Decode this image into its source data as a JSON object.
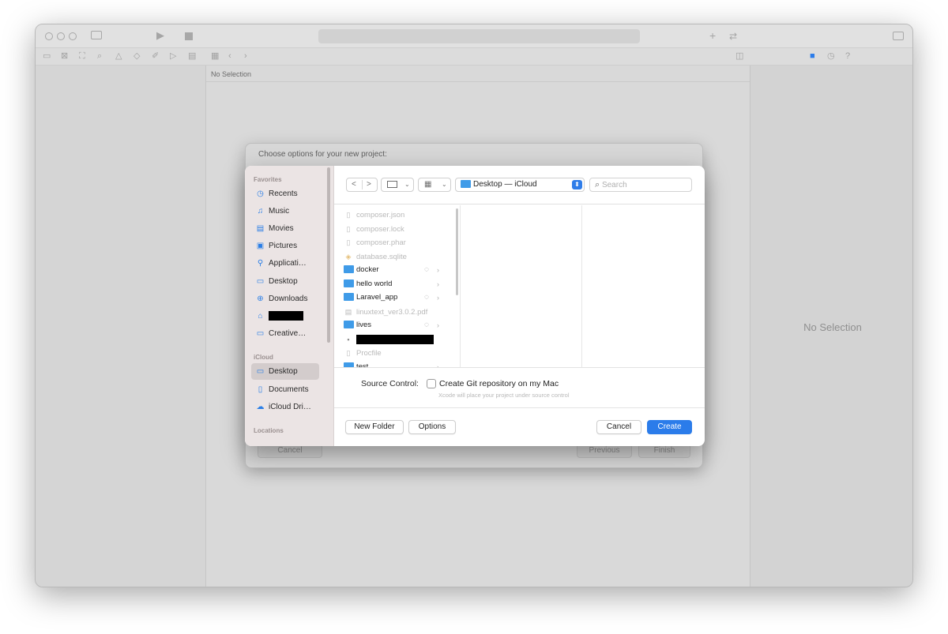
{
  "window": {
    "jump_bar": "No Selection",
    "inspector_empty": "No Selection",
    "toolbar_icons": [
      "sidebar-icon",
      "play-icon",
      "stop-icon",
      "plus-icon",
      "swap-icon",
      "inspector-toggle-icon"
    ],
    "nav_icons": [
      "folder-icon",
      "source-control-icon",
      "hierarchy-icon",
      "search-icon",
      "warning-icon",
      "test-icon",
      "debug-icon",
      "breakpoint-icon",
      "report-icon"
    ],
    "inspector_icons": [
      "file-icon",
      "history-icon",
      "help-icon"
    ]
  },
  "template_sheet": {
    "title": "Choose options for your new project:",
    "cancel": "Cancel",
    "previous": "Previous",
    "finish": "Finish"
  },
  "save_panel": {
    "sidebar": {
      "favorites_header": "Favorites",
      "favorites": [
        {
          "label": "Recents",
          "icon": "clock-icon"
        },
        {
          "label": "Music",
          "icon": "music-icon"
        },
        {
          "label": "Movies",
          "icon": "film-icon"
        },
        {
          "label": "Pictures",
          "icon": "photo-icon"
        },
        {
          "label": "Applicati…",
          "icon": "apps-icon"
        },
        {
          "label": "Desktop",
          "icon": "desktop-icon"
        },
        {
          "label": "Downloads",
          "icon": "download-icon"
        },
        {
          "label": "",
          "icon": "home-icon"
        },
        {
          "label": "Creative…",
          "icon": "folder-icon"
        }
      ],
      "icloud_header": "iCloud",
      "icloud": [
        {
          "label": "Desktop",
          "icon": "desktop-icon"
        },
        {
          "label": "Documents",
          "icon": "document-icon"
        },
        {
          "label": "iCloud Dri…",
          "icon": "cloud-icon"
        }
      ],
      "locations_header": "Locations"
    },
    "toolbar": {
      "back": "<",
      "forward": ">",
      "location": "Desktop — iCloud",
      "search_placeholder": "Search"
    },
    "files": [
      {
        "name": "composer.json",
        "dim": true,
        "icon": "json-file-icon"
      },
      {
        "name": "composer.lock",
        "dim": true,
        "icon": "file-icon"
      },
      {
        "name": "composer.phar",
        "dim": true,
        "icon": "file-icon"
      },
      {
        "name": "database.sqlite",
        "dim": true,
        "icon": "database-file-icon"
      },
      {
        "name": "docker",
        "folder": true,
        "cloud": true,
        "chevron": true
      },
      {
        "name": "hello world",
        "folder": true,
        "chevron": true
      },
      {
        "name": "Laravel_app",
        "folder": true,
        "cloud": true,
        "chevron": true
      },
      {
        "name": "linuxtext_ver3.0.2.pdf",
        "dim": true,
        "icon": "pdf-file-icon"
      },
      {
        "name": "lives",
        "folder": true,
        "cloud": true,
        "chevron": true
      },
      {
        "name": "",
        "redacted": true,
        "icon": "lock-file-icon"
      },
      {
        "name": "Procfile",
        "dim": true,
        "icon": "file-icon"
      },
      {
        "name": "test",
        "folder": true,
        "chevron": true
      }
    ],
    "source_control_label": "Source Control:",
    "git_checkbox_label": "Create Git repository on my Mac",
    "git_hint": "Xcode will place your project under source control",
    "new_folder": "New Folder",
    "options": "Options",
    "cancel": "Cancel",
    "create": "Create"
  }
}
